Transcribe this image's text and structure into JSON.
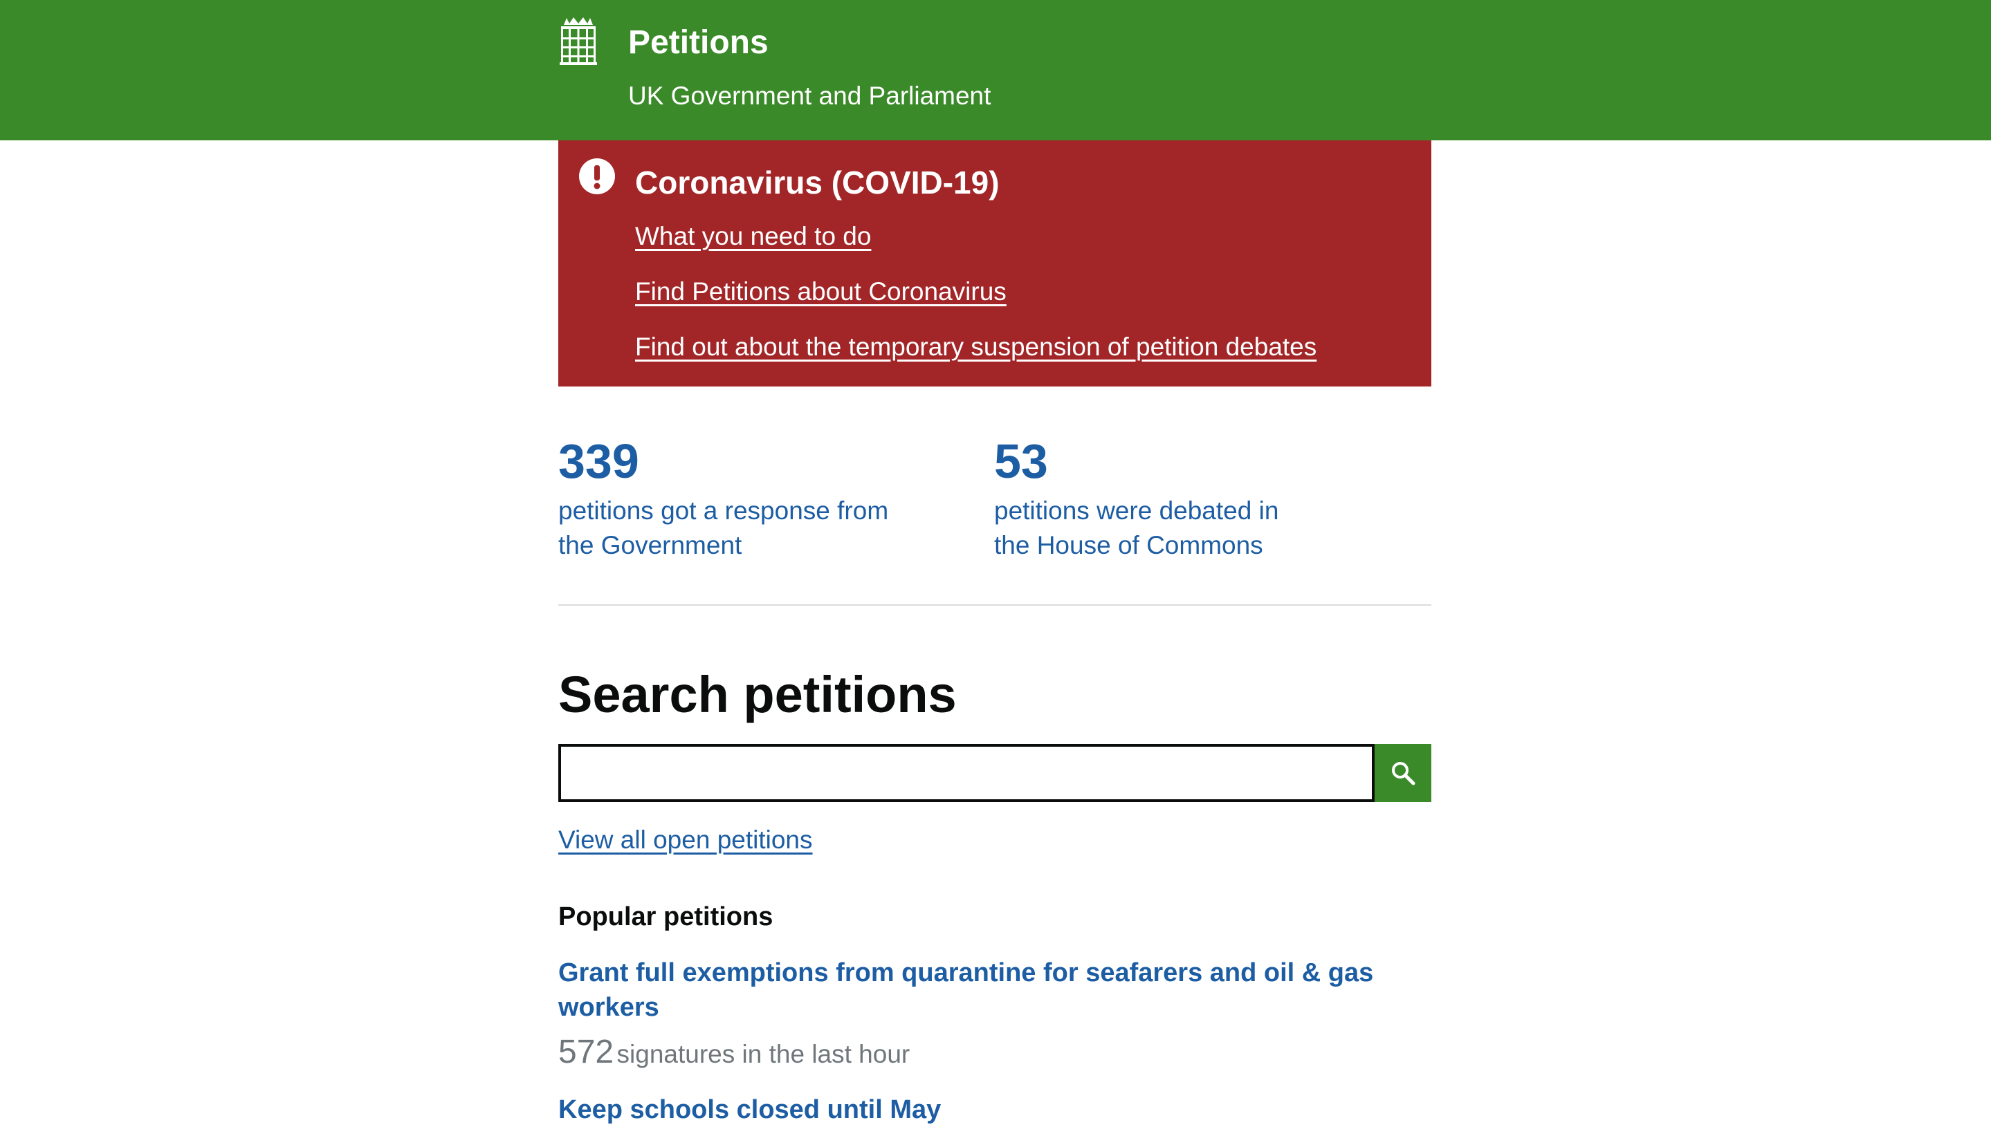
{
  "header": {
    "title": "Petitions",
    "subtitle": "UK Government and Parliament"
  },
  "alert": {
    "title": "Coronavirus (COVID-19)",
    "links": [
      "What you need to do",
      "Find Petitions about Coronavirus",
      "Find out about the temporary suspension of petition debates"
    ]
  },
  "stats": [
    {
      "number": "339",
      "line1": "petitions got a response from",
      "line2": "the Government"
    },
    {
      "number": "53",
      "line1": "petitions were debated in",
      "line2": "the House of Commons"
    }
  ],
  "search": {
    "heading": "Search petitions",
    "value": "",
    "view_all_label": "View all open petitions"
  },
  "popular": {
    "heading": "Popular petitions",
    "items": [
      {
        "title": "Grant full exemptions from quarantine for seafarers and oil & gas workers",
        "count": "572",
        "label": "signatures in the last hour"
      },
      {
        "title": "Keep schools closed until May"
      }
    ]
  },
  "colors": {
    "header_green": "#3b8a29",
    "alert_red": "#a22628",
    "link_blue": "#1d5da3"
  }
}
